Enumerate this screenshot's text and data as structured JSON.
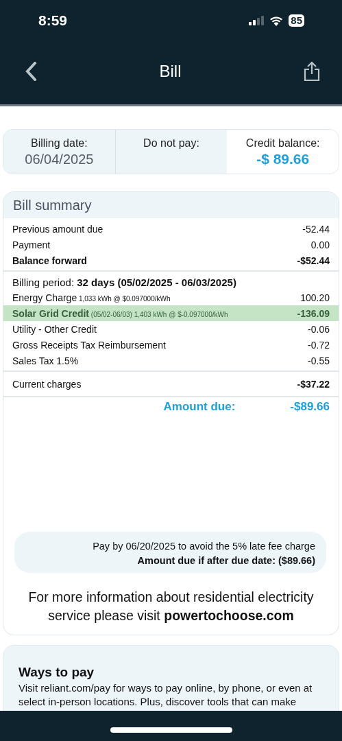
{
  "status_bar": {
    "time": "8:59",
    "battery": "85"
  },
  "nav": {
    "title": "Bill"
  },
  "summary": [
    {
      "label": "Billing date:",
      "value": "06/04/2025",
      "kind": "date"
    },
    {
      "label": "Do not pay:",
      "kind": "empty"
    },
    {
      "label": "Credit balance:",
      "value": "-$ 89.66",
      "kind": "credit"
    }
  ],
  "bill_summary": {
    "title": "Bill summary",
    "balance_rows": [
      {
        "label": "Previous amount due",
        "amount": "-52.44",
        "bold": false
      },
      {
        "label": "Payment",
        "amount": "0.00",
        "bold": false
      },
      {
        "label": "Balance forward",
        "amount": "-$52.44",
        "bold": true
      }
    ],
    "billing_period": "Billing period: **32 days (05/02/2025  - 06/03/2025)**",
    "charges": [
      {
        "label": "Energy Charge",
        "detail": "1,033 kWh  @ $0.097000/kWh",
        "amount": "100.20",
        "highlighted": false
      },
      {
        "label": "Solar Grid Credit",
        "detail": "(05/02-06/03) 1,403 kWh  @ $-0.097000/kWh",
        "amount": "-136.09",
        "highlighted": true
      },
      {
        "label": "Utility - Other Credit",
        "amount": "-0.06",
        "highlighted": false
      },
      {
        "label": "Gross Receipts Tax Reimbursement",
        "amount": "-0.72",
        "highlighted": false
      },
      {
        "label": "Sales Tax  1.5%",
        "amount": "-0.55",
        "highlighted": false
      }
    ],
    "current_charges": {
      "label": "Current charges",
      "amount": "-$37.22"
    },
    "amount_due": {
      "label": "Amount due:",
      "amount": "-$89.66"
    },
    "late_fee_notice": "Pay by 06/20/2025 to avoid the 5% late fee charge",
    "late_amount": "Amount due if after due date:  ($89.66)",
    "info_text": "For more information about residential electricity service please visit ",
    "info_link": "powertochoose.com"
  },
  "ways_to_pay": {
    "title": "Ways to pay",
    "text": "Visit reliant.com/pay for ways to pay online, by phone, or even at select in-person locations. Plus, discover tools that can make"
  }
}
